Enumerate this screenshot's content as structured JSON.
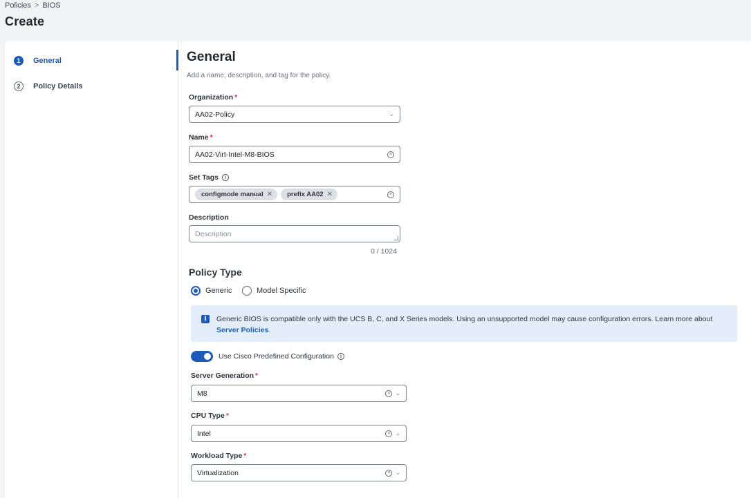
{
  "breadcrumb": {
    "parent": "Policies",
    "separator": ">",
    "current": "BIOS"
  },
  "page_title": "Create",
  "steps": [
    {
      "number": "1",
      "label": "General"
    },
    {
      "number": "2",
      "label": "Policy Details"
    }
  ],
  "form": {
    "title": "General",
    "subtitle": "Add a name, description, and tag for the policy.",
    "organization": {
      "label": "Organization",
      "required_mark": "*",
      "value": "AA02-Policy"
    },
    "name": {
      "label": "Name",
      "required_mark": "*",
      "value": "AA02-Virt-Intel-M8-BIOS"
    },
    "tags": {
      "label": "Set Tags",
      "items": [
        "configmode manual",
        "prefix AA02"
      ]
    },
    "description": {
      "label": "Description",
      "placeholder": "Description",
      "counter": "0 / 1024"
    },
    "policy_type": {
      "title": "Policy Type",
      "options": [
        "Generic",
        "Model Specific"
      ],
      "selected": "Generic"
    },
    "banner": {
      "text": "Generic BIOS is compatible only with the UCS B, C, and X Series models. Using an unsupported model may cause configuration errors. Learn more about ",
      "link": "Server Policies",
      "suffix": "."
    },
    "predefined": {
      "label": "Use Cisco Predefined Configuration",
      "enabled": true
    },
    "server_generation": {
      "label": "Server Generation",
      "required_mark": "*",
      "value": "M8"
    },
    "cpu_type": {
      "label": "CPU Type",
      "required_mark": "*",
      "value": "Intel"
    },
    "workload_type": {
      "label": "Workload Type",
      "required_mark": "*",
      "value": "Virtualization"
    }
  },
  "colors": {
    "accent": "#1d5bb9",
    "required": "#d9304a",
    "banner_bg": "#e3edfa"
  },
  "icons": {
    "clear": "circle-x-icon",
    "dropdown": "chevron-down-icon",
    "info": "info-icon",
    "tag_remove": "close-icon"
  }
}
